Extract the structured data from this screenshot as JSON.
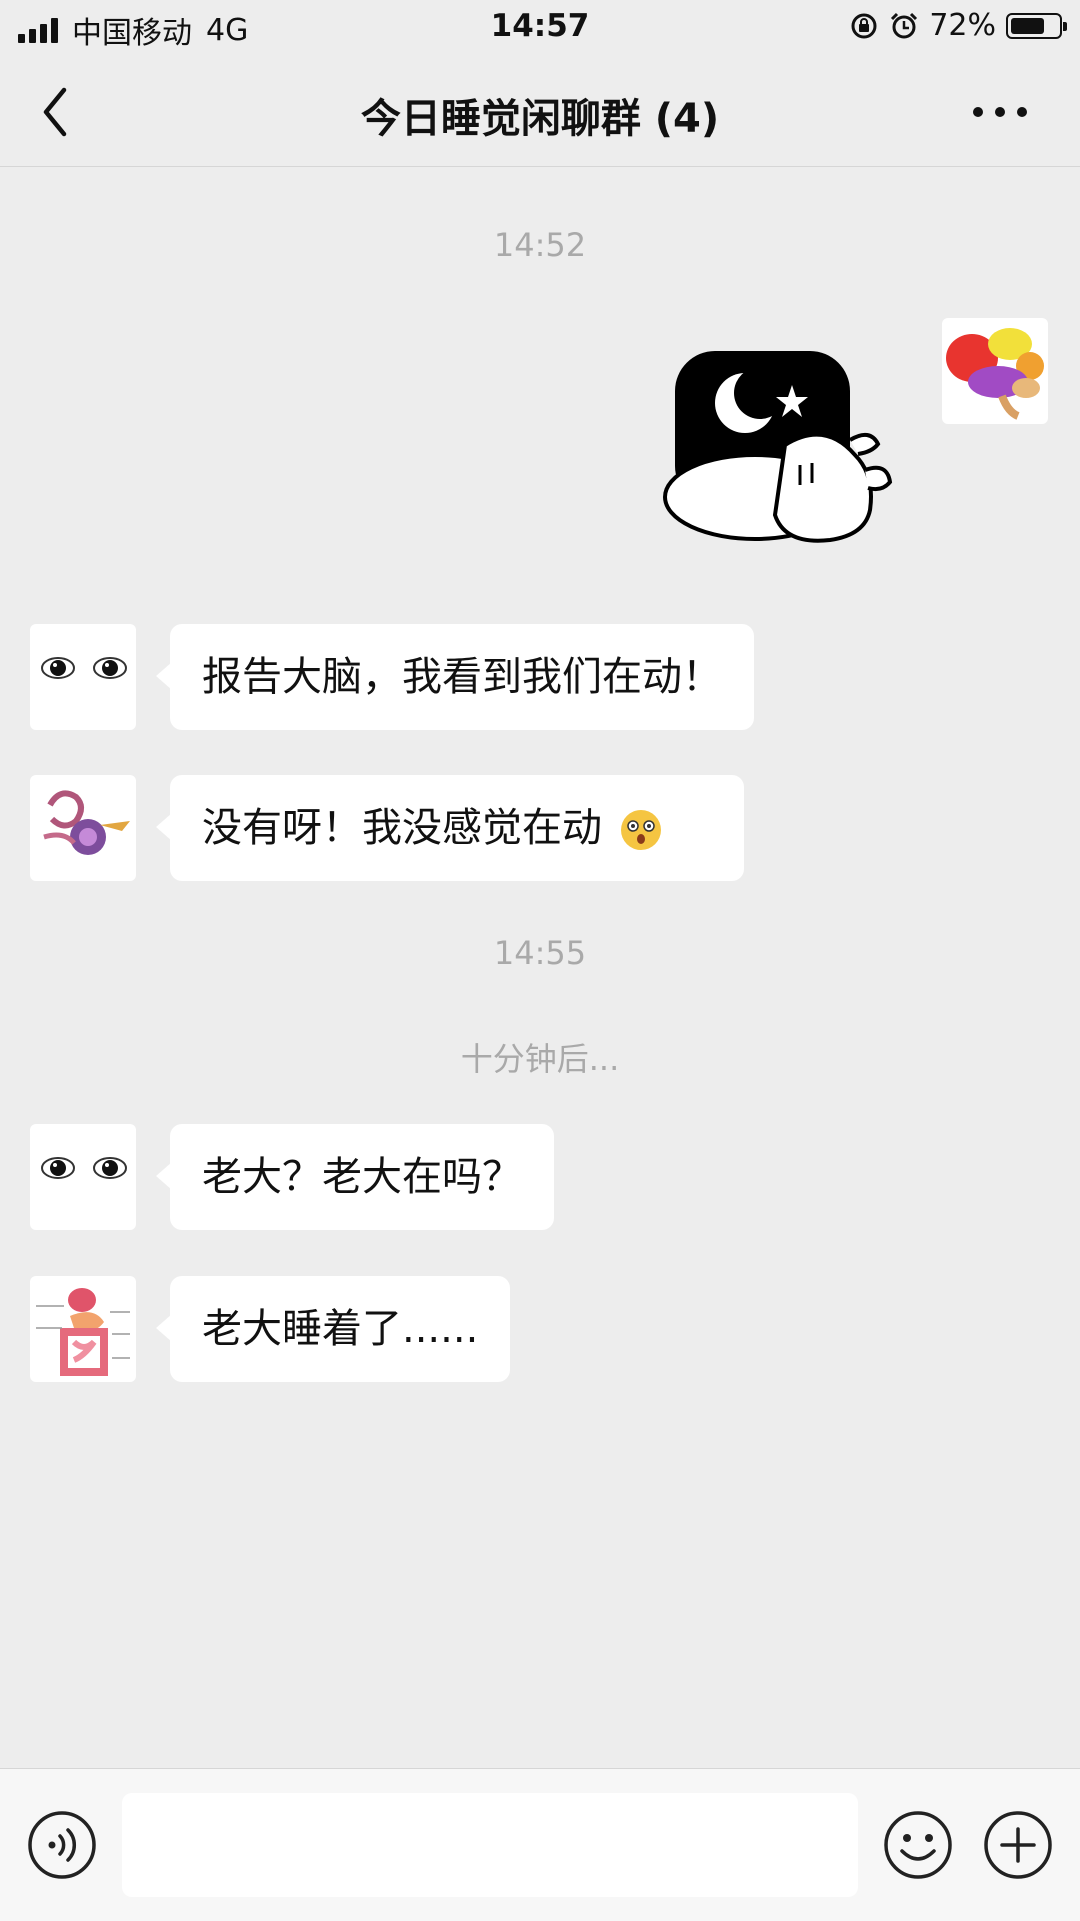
{
  "status_bar": {
    "carrier": "中国移动",
    "network": "4G",
    "time": "14:57",
    "battery": "72%",
    "battery_level": 0.72
  },
  "nav": {
    "title": "今日睡觉闲聊群 (4)",
    "back_icon": "chevron-left-icon",
    "more_icon": "more-icon"
  },
  "chat": {
    "timestamps": [
      "14:52",
      "14:55"
    ],
    "system_note": "十分钟后...",
    "messages": [
      {
        "sender": "brain",
        "type": "sticker",
        "side": "right"
      },
      {
        "sender": "eyes",
        "type": "text",
        "text": "报告大脑，我看到我们在动！"
      },
      {
        "sender": "ear",
        "type": "text",
        "text": "没有呀！我没感觉在动"
      },
      {
        "sender": "eyes",
        "type": "text",
        "text": "老大？老大在吗？"
      },
      {
        "sender": "stomach",
        "type": "text",
        "text": "老大睡着了......"
      }
    ]
  },
  "input_bar": {
    "placeholder": "",
    "icons": [
      "voice-icon",
      "emoji-icon",
      "plus-icon"
    ]
  },
  "colors": {
    "background": "#ededed",
    "bubble": "#ffffff",
    "timestamp": "#a9a9a9"
  }
}
